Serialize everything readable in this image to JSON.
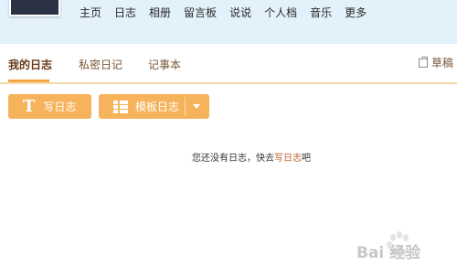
{
  "nav": {
    "items": [
      "主页",
      "日志",
      "相册",
      "留言板",
      "说说",
      "个人档",
      "音乐",
      "更多"
    ]
  },
  "tabs": {
    "items": [
      "我的日志",
      "私密日记",
      "记事本"
    ],
    "draft_label": "草稿"
  },
  "actions": {
    "write_label": "写日志",
    "write_icon": "T",
    "template_label": "模板日志"
  },
  "empty": {
    "prefix": "您还没有日志，快去",
    "link": "写日志",
    "suffix": "吧"
  },
  "watermark": {
    "text": "Bai 经验"
  },
  "colors": {
    "header_bg": "#e3f1fb",
    "accent": "#f6b35b",
    "tab_line": "#f6d9ab",
    "link": "#b8622a"
  }
}
